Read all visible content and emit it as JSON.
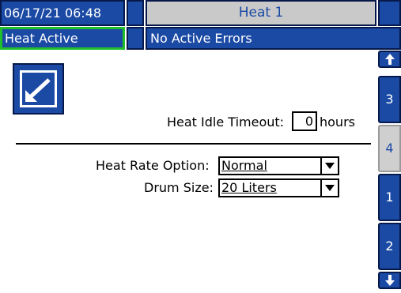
{
  "header": {
    "datetime": "06/17/21 06:48",
    "screen_title": "Heat 1",
    "heat_status": "Heat Active",
    "error_status": "No Active Errors"
  },
  "settings": {
    "heat_idle_timeout_label": "Heat Idle Timeout:",
    "heat_idle_timeout_value": "0",
    "heat_idle_timeout_unit": "hours",
    "heat_rate_label": "Heat Rate Option:",
    "heat_rate_value": "Normal",
    "drum_size_label": "Drum Size:",
    "drum_size_value": "20 Liters"
  },
  "tabs": {
    "items": [
      {
        "label": "3",
        "active": false
      },
      {
        "label": "4",
        "active": true
      },
      {
        "label": "1",
        "active": false
      },
      {
        "label": "2",
        "active": false
      }
    ]
  },
  "icons": {
    "edit": "edit-icon",
    "scroll_up": "arrow-up-icon",
    "scroll_down": "arrow-down-icon",
    "dropdown": "chevron-down-icon"
  },
  "colors": {
    "primary_blue": "#1b4aa5",
    "dark_border": "#06194a",
    "active_green": "#1fbf2a",
    "inactive_gray": "#c9c9c9"
  }
}
